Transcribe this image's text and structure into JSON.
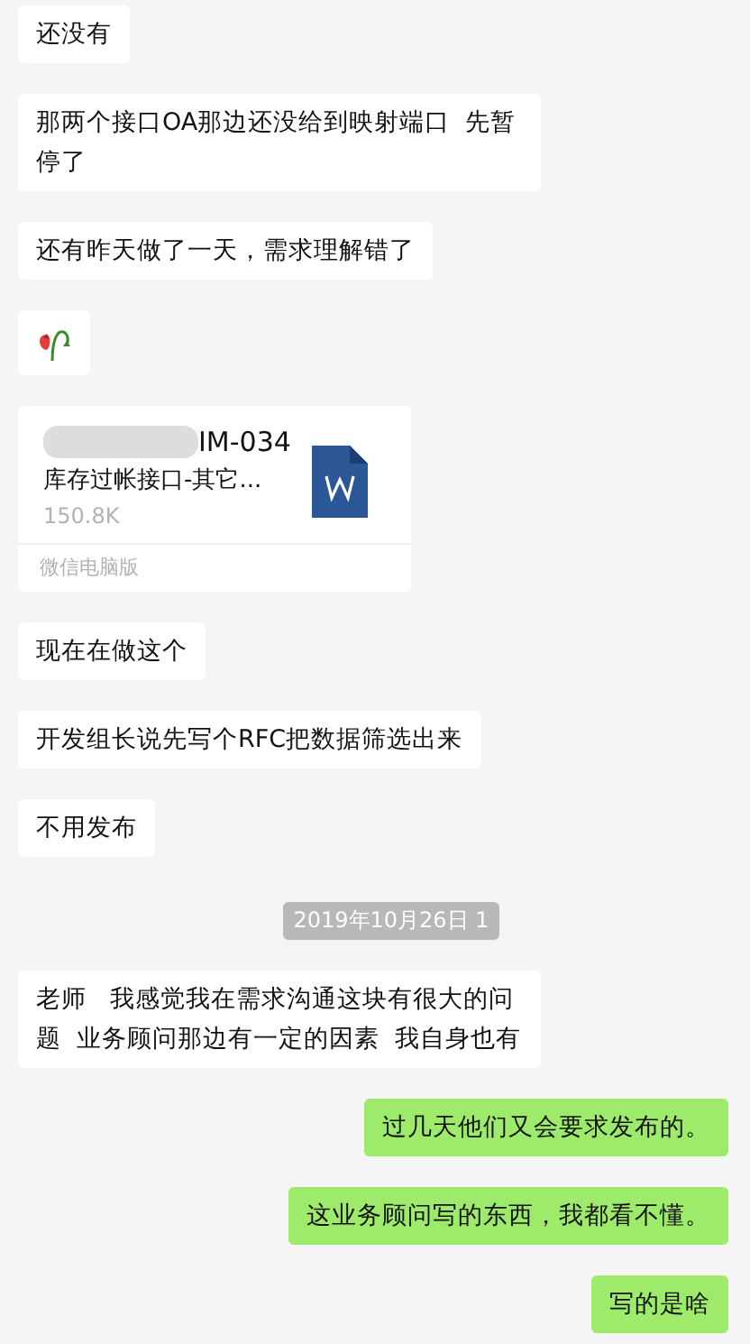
{
  "messages": [
    {
      "kind": "received",
      "text": "还没有"
    },
    {
      "kind": "received",
      "text": "那两个接口OA那边还没给到映射端口  先暂停了"
    },
    {
      "kind": "received",
      "text": "还有昨天做了一天，需求理解错了"
    },
    {
      "kind": "emoji"
    },
    {
      "kind": "file",
      "name": "IM-034",
      "subtitle": "库存过帐接口-其它...",
      "size": "150.8K",
      "source": "微信电脑版"
    },
    {
      "kind": "received",
      "text": "现在在做这个"
    },
    {
      "kind": "received",
      "text": "开发组长说先写个RFC把数据筛选出来"
    },
    {
      "kind": "received",
      "text": "不用发布"
    },
    {
      "kind": "time",
      "text": "2019年10月26日 1"
    },
    {
      "kind": "received",
      "text": "老师   我感觉我在需求沟通这块有很大的问题  业务顾问那边有一定的因素  我自身也有"
    },
    {
      "kind": "sent",
      "text": "过几天他们又会要求发布的。"
    },
    {
      "kind": "sent",
      "text": "这业务顾问写的东西，我都看不懂。"
    },
    {
      "kind": "sent",
      "text": "写的是啥"
    }
  ]
}
